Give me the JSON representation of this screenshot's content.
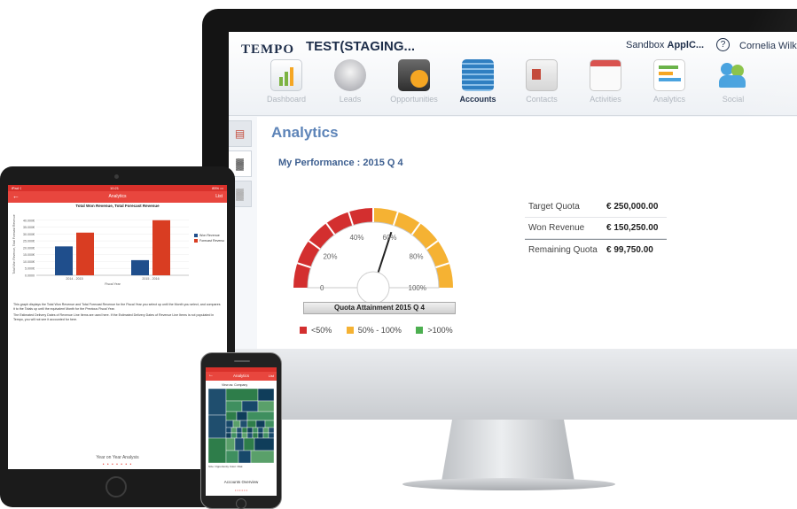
{
  "desktop": {
    "logo_text": "TEMPO",
    "app_title": "TEST(STAGING...",
    "sandbox_prefix": "Sandbox",
    "sandbox_app": "ApplC...",
    "help_glyph": "?",
    "user_name": "Cornelia Wilke",
    "user_caret": "▾",
    "nav": [
      {
        "label": "Dashboard",
        "icon": "dashboard-icon",
        "color": "#7cb342"
      },
      {
        "label": "Leads",
        "icon": "leads-icon",
        "color": "#9e9fa6"
      },
      {
        "label": "Opportunities",
        "icon": "opportunities-icon",
        "color": "#f5a623"
      },
      {
        "label": "Accounts",
        "icon": "accounts-icon",
        "color": "#2f7fc1",
        "active": true
      },
      {
        "label": "Contacts",
        "icon": "contacts-icon",
        "color": "#c44b3b"
      },
      {
        "label": "Activities",
        "icon": "activities-icon",
        "color": "#d9534f"
      },
      {
        "label": "Analytics",
        "icon": "analytics-icon",
        "color": "#6bb34a"
      },
      {
        "label": "Social",
        "icon": "social-icon",
        "color": "#4aa3df"
      }
    ],
    "side_tabs": [
      "▤",
      "▓",
      "▓"
    ],
    "analytics_title": "Analytics",
    "performance_title": "My Performance : 2015 Q 4",
    "gauge": {
      "caption": "Quota Attainment 2015 Q 4",
      "value_percent": 60,
      "tick_labels": [
        "0",
        "20%",
        "40%",
        "60%",
        "80%",
        "100%"
      ],
      "colors": {
        "low": "#d32f2f",
        "mid": "#f5b233",
        "high": "#4caf50"
      }
    },
    "legend": [
      {
        "label": "<50%",
        "color": "#d32f2f"
      },
      {
        "label": "50% - 100%",
        "color": "#f5b233"
      },
      {
        "label": ">100%",
        "color": "#4caf50"
      }
    ],
    "quota": [
      {
        "label": "Target Quota",
        "value": "€ 250,000.00"
      },
      {
        "label": "Won Revenue",
        "value": "€ 150,250.00"
      },
      {
        "label": "Remaining Quota",
        "value": "€ 99,750.00"
      }
    ]
  },
  "tablet": {
    "status_left": "iPad ☇",
    "status_time": "10:21",
    "status_right": "85% ▭",
    "back_glyph": "←",
    "title": "Analytics",
    "list_label": "List",
    "bottom_caption": "Year on Year Analysis",
    "dots": "• • • • • • •",
    "description": [
      "This graph displays the Total Won Revenue and Total Forecast Revenue for the Fiscal Year you select up until the Month you select, and compares it to the Totals up until the equivalent Month for the Previous Fiscal Year.",
      "The Estimated Delivery Dates of Revenue Line Items are used here. If the Estimated Delivery Dates of Revenue Line Items is not populated in Tempo, you will not see it accounted for here."
    ]
  },
  "chart_data": {
    "type": "bar",
    "title": "Total Won Revenue, Total Forecast Revenue",
    "xlabel": "Fiscal Year",
    "ylabel": "Total Won Revenue, Total Forecast Revenue",
    "categories": [
      "2014 - 2015",
      "2015 - 2016"
    ],
    "series": [
      {
        "name": "Won Revenue",
        "values": [
          21000,
          11000
        ],
        "color": "#1f4e8c"
      },
      {
        "name": "Forecast Revenue",
        "values": [
          31000,
          40000
        ],
        "color": "#d93d22"
      }
    ],
    "ylim": [
      0,
      45000
    ],
    "yticks": [
      "0.0000",
      "5.000€",
      "10.000€",
      "15.000€",
      "20.000€",
      "25.000€",
      "30.000€",
      "35.000€",
      "40.000€"
    ],
    "legend_position": "right"
  },
  "phone": {
    "back_glyph": "←",
    "title": "Analytics",
    "list_label": "List",
    "filter_label": "View as: Company",
    "legend_text": "Size: Opportunity   Color: Risk",
    "caption": "Accounts Overview",
    "dots": "• • • • • •",
    "treemap_colors": [
      "#1f4e6e",
      "#2e7d4a",
      "#0f3d5a",
      "#3f8f5f",
      "#17486a",
      "#5aa06a"
    ]
  }
}
